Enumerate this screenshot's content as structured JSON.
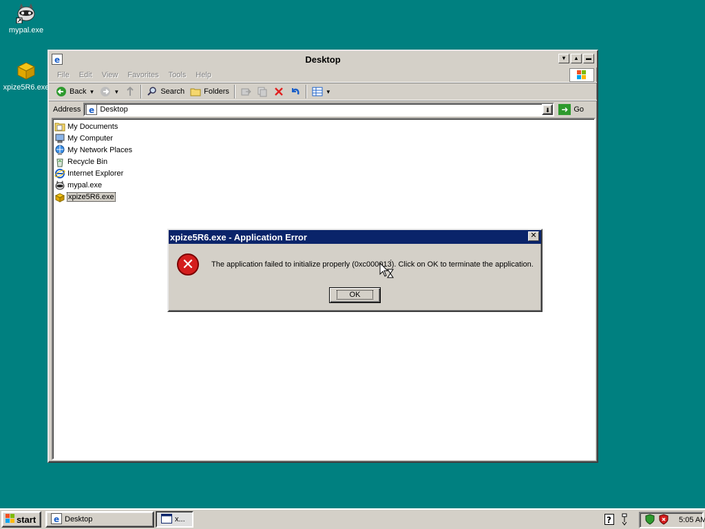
{
  "desktop": {
    "icons": [
      {
        "label": "mypal.exe"
      },
      {
        "label": "xpize5R6.exe"
      }
    ]
  },
  "explorer": {
    "title": "Desktop",
    "menu": [
      "File",
      "Edit",
      "View",
      "Favorites",
      "Tools",
      "Help"
    ],
    "toolbar": {
      "back_label": "Back",
      "search_label": "Search",
      "folders_label": "Folders"
    },
    "address": {
      "label": "Address",
      "value": "Desktop",
      "go_label": "Go"
    },
    "items": [
      {
        "label": "My Documents"
      },
      {
        "label": "My Computer"
      },
      {
        "label": "My Network Places"
      },
      {
        "label": "Recycle Bin"
      },
      {
        "label": "Internet Explorer"
      },
      {
        "label": "mypal.exe"
      },
      {
        "label": "xpize5R6.exe",
        "selected": true
      }
    ]
  },
  "dialog": {
    "title": "xpize5R6.exe - Application Error",
    "message": "The application failed to initialize properly (0xc000013́). Click on OK to terminate the application.",
    "ok_label": "OK"
  },
  "taskbar": {
    "start_label": "start",
    "tasks": [
      {
        "label": "Desktop"
      },
      {
        "label": "x..."
      }
    ],
    "clock": "5:05 AM"
  },
  "colors": {
    "desktop_bg": "#008080",
    "dialog_title_bg": "#0a246a",
    "error_icon": "#d41d1d"
  }
}
